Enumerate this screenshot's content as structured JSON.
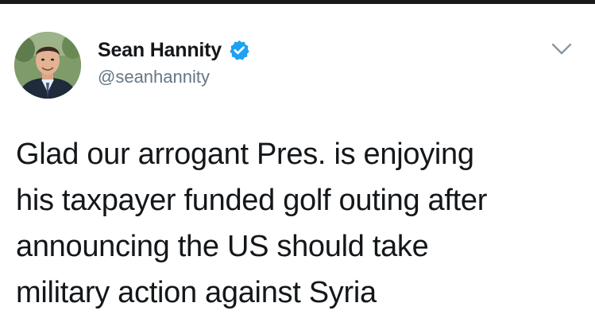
{
  "tweet": {
    "author": {
      "display_name": "Sean Hannity",
      "handle": "@seanhannity",
      "verified": true,
      "avatar_icon": "profile-photo"
    },
    "menu_icon": "chevron-down-icon",
    "text": "Glad our arrogant Pres. is enjoying\nhis taxpayer funded golf outing after\nannouncing the US should take\nmilitary action against Syria"
  },
  "colors": {
    "verified_badge": "#1da1f2",
    "handle": "#657786",
    "text": "#14171a",
    "caret": "#8899a6"
  }
}
